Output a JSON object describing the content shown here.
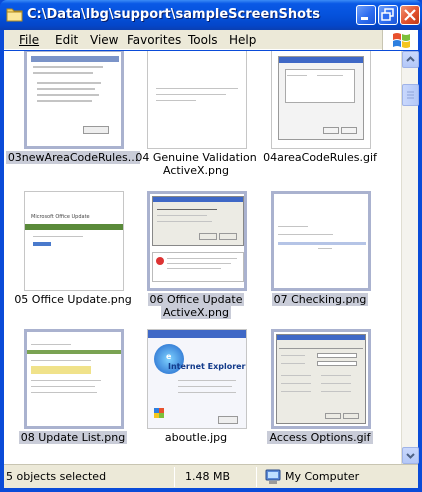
{
  "window": {
    "title": "C:\\Data\\lbg\\support\\sampleScreenShots",
    "icon": "folder-icon",
    "controls": [
      "minimize-icon",
      "maximize-icon",
      "close-icon"
    ]
  },
  "menu": [
    {
      "label": "File"
    },
    {
      "label": "Edit"
    },
    {
      "label": "View"
    },
    {
      "label": "Favorites"
    },
    {
      "label": "Tools"
    },
    {
      "label": "Help"
    }
  ],
  "files": [
    {
      "line1": "03newAreaCodeRules...",
      "line2": "",
      "selected": true
    },
    {
      "line1": "04 Genuine Validation",
      "line2": "ActiveX.png",
      "selected": false
    },
    {
      "line1": "04areaCodeRules.gif",
      "line2": "",
      "selected": false
    },
    {
      "line1": "05 Office Update.png",
      "line2": "",
      "selected": false
    },
    {
      "line1": "06 Office Update",
      "line2": "ActiveX.png",
      "selected": true
    },
    {
      "line1": "07 Checking.png",
      "line2": "",
      "selected": true
    },
    {
      "line1": "08 Update List.png",
      "line2": "",
      "selected": true
    },
    {
      "line1": "aboutIe.jpg",
      "line2": "",
      "selected": false
    },
    {
      "line1": "Access Options.gif",
      "line2": "",
      "selected": true
    }
  ],
  "thumbnail_text": {
    "f4": "Microsoft Office Update",
    "f7": "Internet Explorer"
  },
  "status": {
    "selection": "5 objects selected",
    "size": "1.48 MB",
    "zone": "My Computer"
  },
  "colors": {
    "titlebar": "#0552dc",
    "selection_caption": "#c9ccd8",
    "selection_frame": "#aab2cf"
  }
}
